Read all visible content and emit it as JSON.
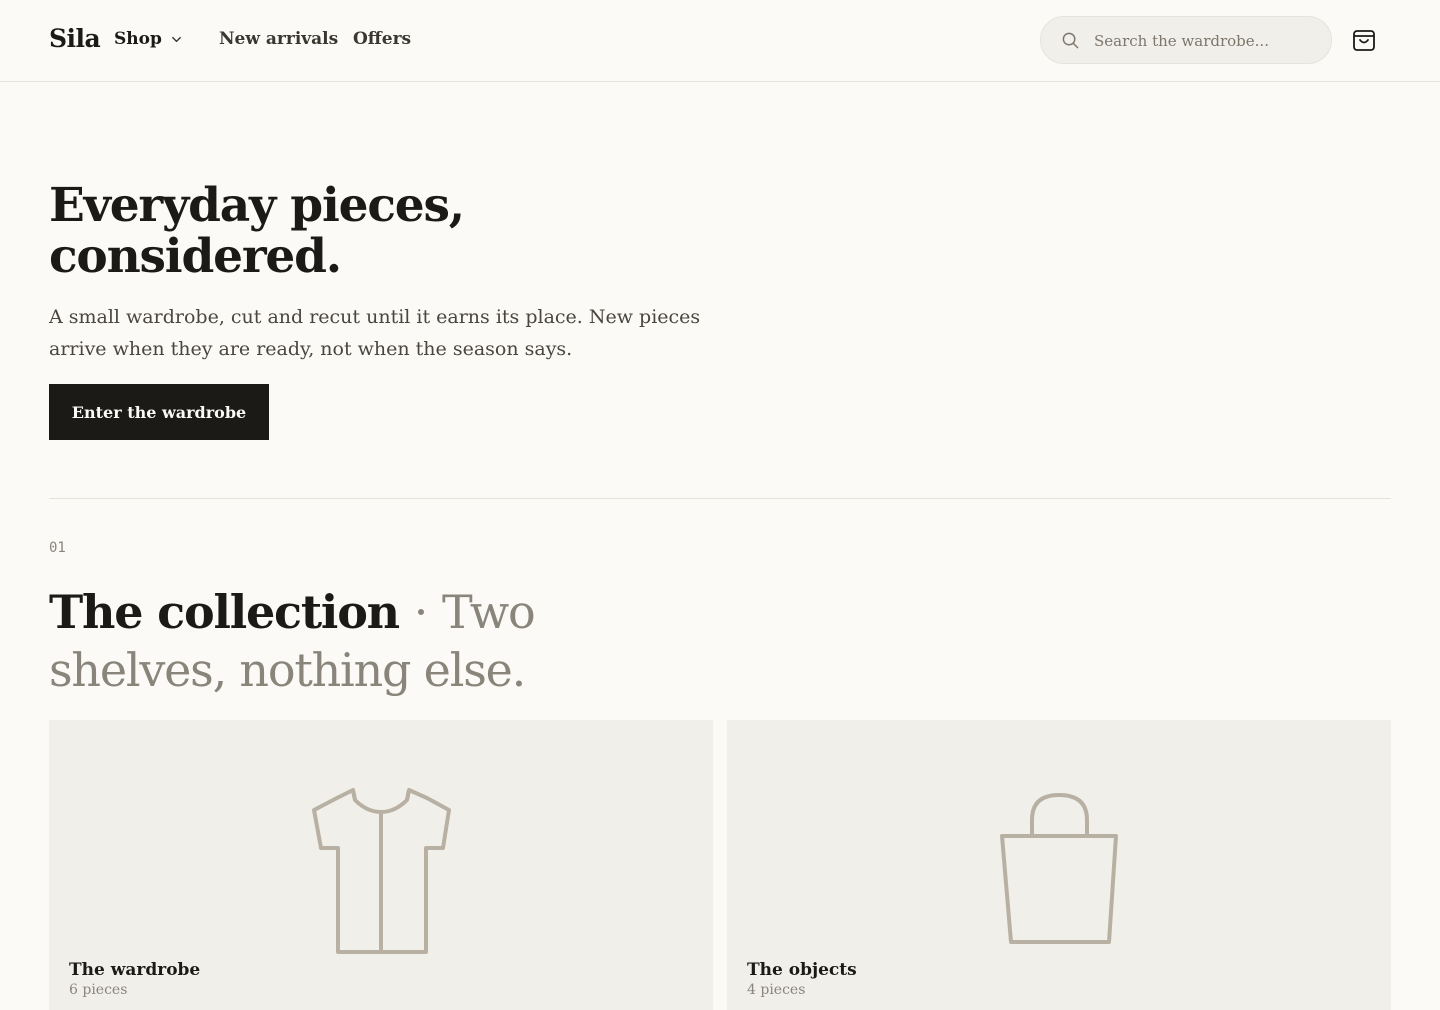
{
  "header": {
    "brand": "Sila",
    "nav": {
      "shop": "Shop",
      "new_arrivals": "New arrivals",
      "offers": "Offers"
    },
    "search": {
      "placeholder": "Search the wardrobe...",
      "value": ""
    },
    "icons": {
      "search": "search-icon",
      "cart": "shopping-bag-icon",
      "shop_dropdown": "chevron-down-icon"
    }
  },
  "hero": {
    "title": "Everyday pieces, considered.",
    "subtitle": "A small wardrobe, cut and recut until it earns its place. New pieces arrive when they are ready, not when the season says.",
    "cta": "Enter the wardrobe"
  },
  "collection": {
    "number": "01",
    "title": "The collection",
    "separator": "·",
    "tagline": "Two shelves, nothing else.",
    "cards": [
      {
        "title": "The wardrobe",
        "count": "6 pieces",
        "icon": "shirt-icon"
      },
      {
        "title": "The objects",
        "count": "4 pieces",
        "icon": "tote-bag-icon"
      }
    ]
  },
  "colors": {
    "background": "#fbfaf7",
    "ink": "#1c1a17",
    "muted": "#8a857b",
    "card": "#f1efea",
    "illustration": "#b8b1a3"
  }
}
